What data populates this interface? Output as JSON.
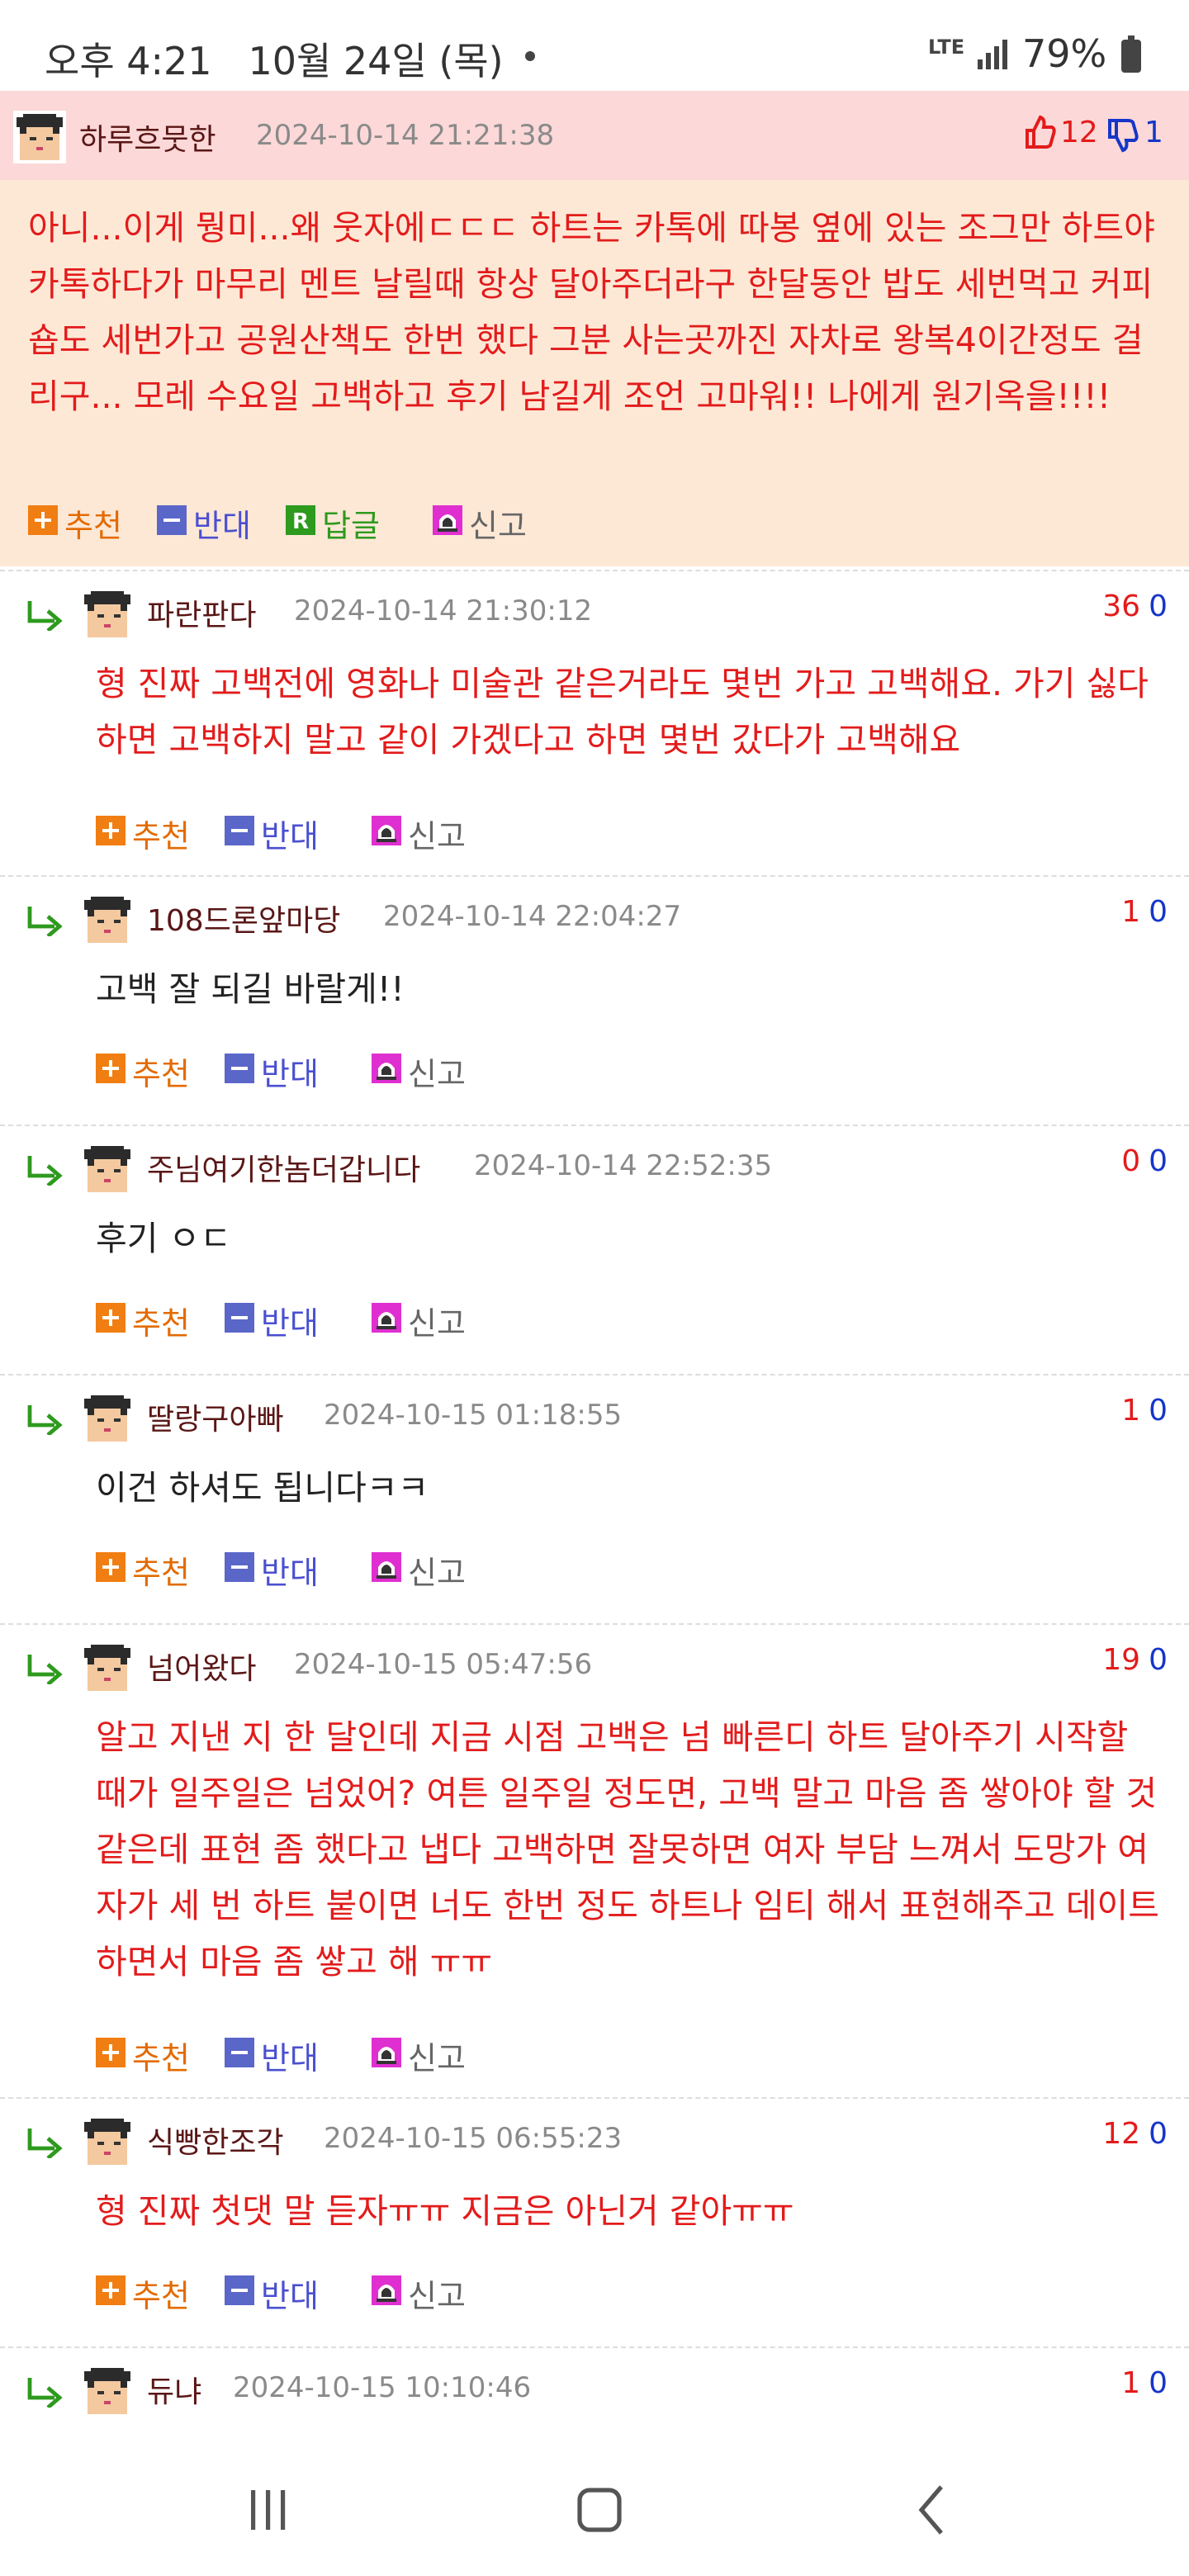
{
  "status_bar": {
    "time": "오후 4:21",
    "date": "10월 24일 (목)",
    "network": "LTE",
    "battery": "79%"
  },
  "post": {
    "nickname": "하루흐뭇한",
    "datetime": "2024-10-14 21:21:38",
    "up": "12",
    "down": "1",
    "body": "아니...이게 뭥미...왜 웃자에ㄷㄷㄷ 하트는 카톡에 따봉 옆에 있는 조그만 하트야 카톡하다가 마무리 멘트 날릴때 항상 달아주더라구 한달동안 밥도 세번먹고 커피숍도 세번가고 공원산책도 한번 했다 그분 사는곳까진 자차로 왕복4이간정도 걸리구... 모레 수요일 고백하고 후기 남길게 조언 고마워!! 나에게 원기옥을!!!!",
    "actions": {
      "recommend": "추천",
      "oppose": "반대",
      "reply": "답글",
      "report": "신고"
    }
  },
  "comment_actions": {
    "recommend": "추천",
    "oppose": "반대",
    "report": "신고"
  },
  "comments": [
    {
      "nickname": "파란판다",
      "datetime": "2024-10-14 21:30:12",
      "up": "36",
      "down": "0",
      "body": "형 진짜 고백전에 영화나 미술관 같은거라도 몇번 가고 고백해요. 가기 싫다하면 고백하지 말고 같이 가겠다고 하면 몇번 갔다가 고백해요"
    },
    {
      "nickname": "108드론앞마당",
      "datetime": "2024-10-14 22:04:27",
      "up": "1",
      "down": "0",
      "body": "고백 잘 되길 바랄게!!"
    },
    {
      "nickname": "주님여기한놈더갑니다",
      "datetime": "2024-10-14 22:52:35",
      "up": "0",
      "down": "0",
      "body": "후기 ㅇㄷ"
    },
    {
      "nickname": "딸랑구아빠",
      "datetime": "2024-10-15 01:18:55",
      "up": "1",
      "down": "0",
      "body": "이건 하셔도 됩니다ㅋㅋ"
    },
    {
      "nickname": "넘어왔다",
      "datetime": "2024-10-15 05:47:56",
      "up": "19",
      "down": "0",
      "body": "알고 지낸 지 한 달인데 지금 시점 고백은 넘 빠른디 하트 달아주기 시작할 때가 일주일은 넘었어? 여튼 일주일 정도면, 고백 말고 마음 좀 쌓아야 할 것 같은데 표현 좀 했다고 냅다 고백하면 잘못하면 여자 부담 느껴서 도망가 여자가 세 번 하트 붙이면 너도 한번 정도 하트나 임티 해서 표현해주고 데이트하면서 마음 좀 쌓고 해 ㅠㅠ"
    },
    {
      "nickname": "식빵한조각",
      "datetime": "2024-10-15 06:55:23",
      "up": "12",
      "down": "0",
      "body": "형 진짜 첫댓 말 듣자ㅠㅠ 지금은 아닌거 같아ㅠㅠ"
    },
    {
      "nickname": "듀냐",
      "datetime": "2024-10-15 10:10:46",
      "up": "1",
      "down": "0",
      "body": ""
    }
  ],
  "colors": {
    "accent_red": "#e31b1b",
    "accent_blue": "#1536c8",
    "recommend": "#e36b00",
    "oppose": "#4a4fd0",
    "reply": "#2e9a1e",
    "report": "#e02fd0"
  }
}
